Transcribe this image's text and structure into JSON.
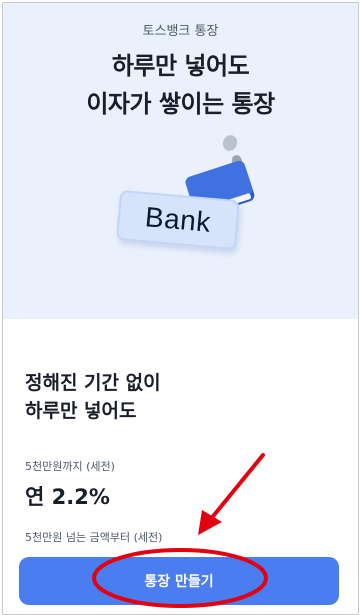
{
  "hero": {
    "eyebrow": "토스뱅크 통장",
    "headline_line1": "하루만 넣어도",
    "headline_line2": "이자가 쌓이는 통장",
    "card_text": "Bank"
  },
  "info": {
    "title_line1": "정해진 기간 없이",
    "title_line2": "하루만 넣어도",
    "tier1_label": "5천만원까지 (세전)",
    "tier1_rate": "연 2.2%",
    "tier2_label": "5천만원 넘는 금액부터 (세전)"
  },
  "cta": {
    "label": "통장 만들기"
  },
  "colors": {
    "hero_bg": "#eaf1fd",
    "accent": "#4a7ef0",
    "annotation": "#e3000f"
  }
}
